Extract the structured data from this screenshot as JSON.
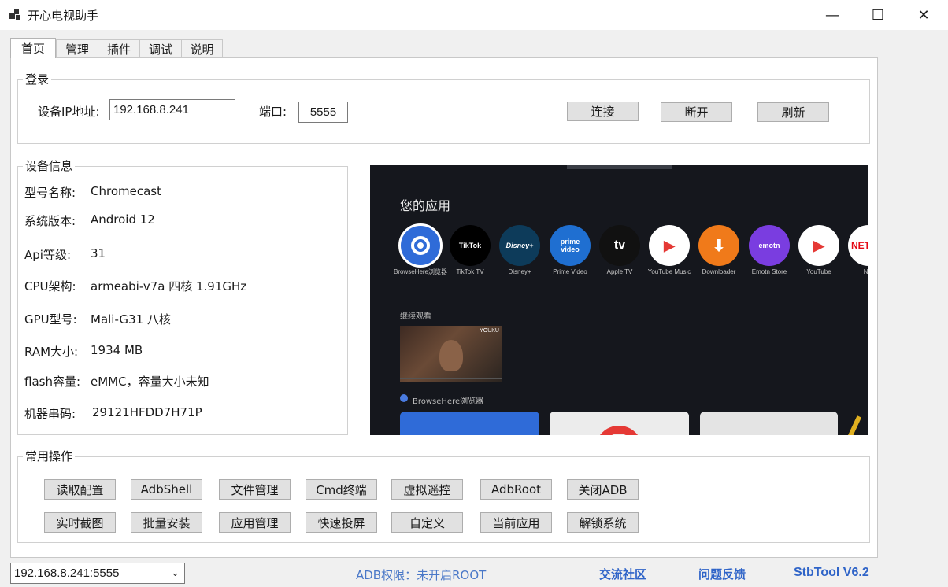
{
  "window": {
    "title": "开心电视助手",
    "minimize": "—",
    "maximize": "☐",
    "close": "✕"
  },
  "tabs": [
    {
      "label": "首页",
      "active": true
    },
    {
      "label": "管理"
    },
    {
      "label": "插件"
    },
    {
      "label": "调试"
    },
    {
      "label": "说明"
    }
  ],
  "login": {
    "title": "登录",
    "ip_label": "设备IP地址:",
    "ip_value": "192.168.8.241",
    "port_label": "端口:",
    "port_value": "5555",
    "connect": "连接",
    "disconnect": "断开",
    "refresh": "刷新"
  },
  "device_info": {
    "title": "设备信息",
    "rows": [
      {
        "key": "型号名称:",
        "value": "Chromecast"
      },
      {
        "key": "系统版本:",
        "value": "Android 12"
      },
      {
        "key": "Api等级:",
        "value": "31"
      },
      {
        "key": "CPU架构:",
        "value": "armeabi-v7a 四核 1.91GHz"
      },
      {
        "key": "GPU型号:",
        "value": "Mali-G31 八核"
      },
      {
        "key": "RAM大小:",
        "value": "1934 MB"
      },
      {
        "key": "flash容量:",
        "value": "eMMC，容量大小未知"
      },
      {
        "key": "机器串码:",
        "value": "29121HFDD7H71P"
      }
    ]
  },
  "tv_screen": {
    "heading": "您的应用",
    "apps": [
      {
        "name": "BrowseHere浏览器",
        "short": "",
        "bg": "#2f6bd8",
        "fg": "#ffffff"
      },
      {
        "name": "TikTok TV",
        "short": "TikTok",
        "bg": "#000000",
        "fg": "#ffffff"
      },
      {
        "name": "Disney+",
        "short": "Disney+",
        "bg": "#0d3b5a",
        "fg": "#ffffff"
      },
      {
        "name": "Prime Video",
        "short": "prime video",
        "bg": "#1f6fd1",
        "fg": "#ffffff"
      },
      {
        "name": "Apple TV",
        "short": "tv",
        "bg": "#111111",
        "fg": "#ffffff"
      },
      {
        "name": "YouTube Music",
        "short": "▶",
        "bg": "#ffffff",
        "fg": "#e53935"
      },
      {
        "name": "Downloader",
        "short": "⬇",
        "bg": "#f07a1a",
        "fg": "#ffffff"
      },
      {
        "name": "Emotn Store",
        "short": "emotn",
        "bg": "#7a3de0",
        "fg": "#ffffff"
      },
      {
        "name": "YouTube",
        "short": "▶",
        "bg": "#ffffff",
        "fg": "#e53935"
      },
      {
        "name": "Net",
        "short": "NETF",
        "bg": "#ffffff",
        "fg": "#e50914"
      }
    ],
    "continue_watching": "继续观看",
    "thumb_badge": "YOUKU",
    "browser_row": "BrowseHere浏览器"
  },
  "operations": {
    "title": "常用操作",
    "row1": [
      "读取配置",
      "AdbShell",
      "文件管理",
      "Cmd终端",
      "虚拟遥控",
      "AdbRoot",
      "关闭ADB"
    ],
    "row2": [
      "实时截图",
      "批量安装",
      "应用管理",
      "快速投屏",
      "自定义",
      "当前应用",
      "解锁系统"
    ]
  },
  "statusbar": {
    "device_select": "192.168.8.241:5555",
    "adb_status": "ADB权限：未开启ROOT",
    "community": "交流社区",
    "feedback": "问题反馈",
    "version": "StbTool V6.2"
  },
  "colors": {
    "accent_link": "#2f64c8",
    "button_bg": "#e1e1e1",
    "tv_bg": "#15171d"
  }
}
